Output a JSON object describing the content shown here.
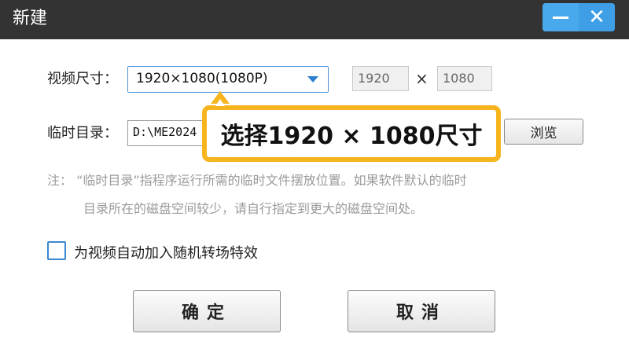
{
  "window": {
    "title": "新建",
    "minimize_icon": "minimize-icon",
    "close_icon": "close-icon",
    "close_glyph": "✕"
  },
  "resolution": {
    "label": "视频尺寸：",
    "selected": "1920×1080(1080P)",
    "width": "1920",
    "height": "1080",
    "separator": "×"
  },
  "temp_dir": {
    "label": "临时目录：",
    "value": "D:\\ME2024",
    "browse_label": "浏览"
  },
  "callout": {
    "text": "选择1920 × 1080尺寸",
    "color": "#f6b51e"
  },
  "note": {
    "line1": "注：  “临时目录”指程序运行所需的临时文件摆放位置。如果软件默认的临时",
    "line2": "目录所在的磁盘空间较少，请自行指定到更大的磁盘空间处。"
  },
  "random_transition": {
    "label": "为视频自动加入随机转场特效",
    "checked": false
  },
  "buttons": {
    "ok": "确定",
    "cancel": "取消"
  },
  "colors": {
    "titlebar": "#333333",
    "accent": "#4aa8ec"
  }
}
